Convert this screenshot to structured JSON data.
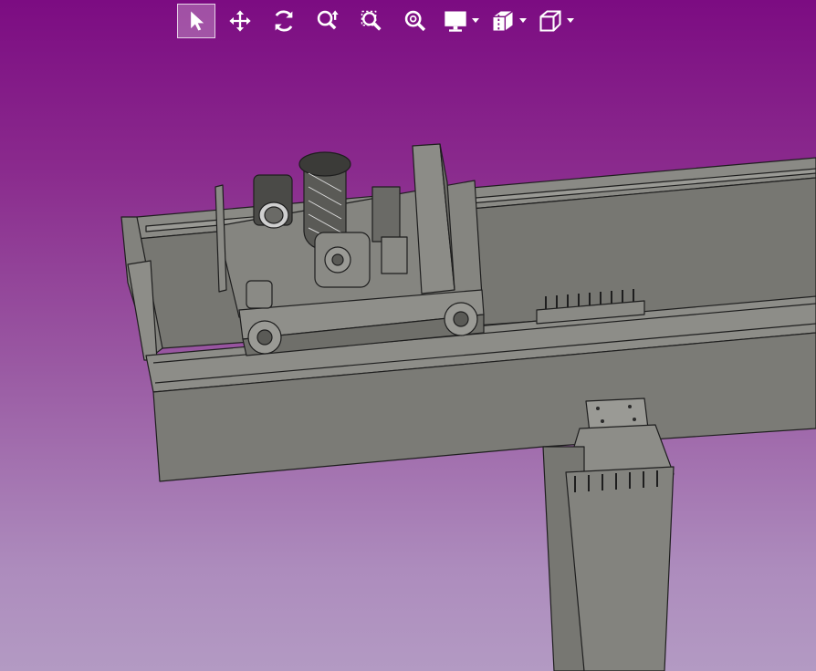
{
  "toolbar": {
    "buttons": [
      {
        "icon": "select-arrow-icon",
        "active": true
      },
      {
        "icon": "pan-move-icon",
        "active": false
      },
      {
        "icon": "rotate-icon",
        "active": false
      },
      {
        "icon": "zoom-dynamic-icon",
        "active": false
      },
      {
        "icon": "zoom-window-icon",
        "active": false
      },
      {
        "icon": "zoom-fit-icon",
        "active": false
      }
    ],
    "dropdowns": [
      {
        "icon": "display-mode-icon"
      },
      {
        "icon": "section-views-icon"
      },
      {
        "icon": "standard-views-cube-icon"
      }
    ]
  },
  "colors": {
    "background_top": "#7c0c82",
    "background_bottom": "#b39ac3",
    "model_fill": "#7f7f7a",
    "model_edge": "#1e1e1e",
    "toolbar_icon": "#ffffff"
  }
}
